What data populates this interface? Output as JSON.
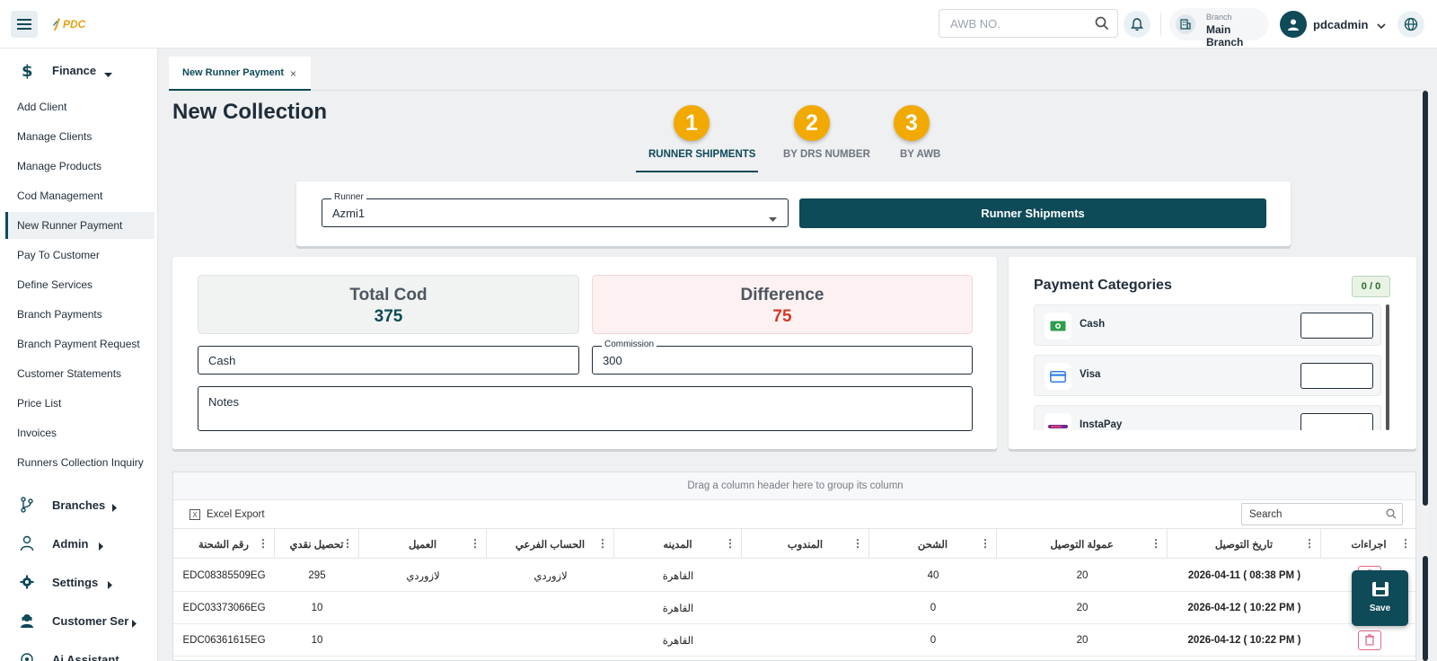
{
  "header": {
    "logo_text": "PDC",
    "awb_placeholder": "AWB NO.",
    "branch_label": "Branch",
    "branch_value": "Main Branch",
    "username": "pdcadmin"
  },
  "sidebar": {
    "finance_label": "Finance",
    "items": [
      {
        "label": "Add Client"
      },
      {
        "label": "Manage Clients"
      },
      {
        "label": "Manage Products"
      },
      {
        "label": "Cod Management"
      },
      {
        "label": "New Runner Payment"
      },
      {
        "label": "Pay To Customer"
      },
      {
        "label": "Define Services"
      },
      {
        "label": "Branch Payments"
      },
      {
        "label": "Branch Payment Request"
      },
      {
        "label": "Customer Statements"
      },
      {
        "label": "Price List"
      },
      {
        "label": "Invoices"
      },
      {
        "label": "Runners Collection Inquiry"
      }
    ],
    "sections": [
      {
        "label": "Branches"
      },
      {
        "label": "Admin"
      },
      {
        "label": "Settings"
      },
      {
        "label": "Customer Ser"
      },
      {
        "label": "Ai Assistant"
      }
    ]
  },
  "tabs": [
    {
      "label": "New Runner Payment",
      "close": "×"
    }
  ],
  "page": {
    "title": "New Collection"
  },
  "steps": [
    {
      "num": "1",
      "label": "RUNNER SHIPMENTS",
      "active": true
    },
    {
      "num": "2",
      "label": "BY DRS NUMBER",
      "active": false
    },
    {
      "num": "3",
      "label": "BY AWB",
      "active": false
    }
  ],
  "runner": {
    "label": "Runner",
    "value": "Azmi1",
    "button": "Runner Shipments"
  },
  "summary": {
    "total_cod_label": "Total Cod",
    "total_cod_value": "375",
    "difference_label": "Difference",
    "difference_value": "75",
    "payment_method": "Cash",
    "commission_label": "Commission",
    "commission_value": "300",
    "notes_label": "Notes"
  },
  "payment_categories": {
    "title": "Payment Categories",
    "badge": "0 / 0",
    "items": [
      {
        "label": "Cash",
        "icon": "cash-icon"
      },
      {
        "label": "Visa",
        "icon": "card-icon"
      },
      {
        "label": "InstaPay",
        "icon": "instapay-icon"
      }
    ]
  },
  "grid": {
    "group_hint": "Drag a column header here to group its column",
    "excel_label": "Excel Export",
    "search_placeholder": "Search",
    "columns": [
      "رقم الشحنة",
      "تحصيل نقدي",
      "العميل",
      "الحساب الفرعي",
      "المدينه",
      "المندوب",
      "الشحن",
      "عمولة التوصيل",
      "تاريخ التوصيل",
      "اجراءات"
    ],
    "rows": [
      {
        "awb": "EDC08385509EG",
        "cod": "295",
        "client": "لازوردي",
        "sub": "لازوردي",
        "city": "القاهرة",
        "runner": "",
        "shipping": "40",
        "commission": "20",
        "date": "2026-04-11 ( 08:38 PM )"
      },
      {
        "awb": "EDC03373066EG",
        "cod": "10",
        "client": "",
        "sub": "",
        "city": "القاهرة",
        "runner": "",
        "shipping": "0",
        "commission": "20",
        "date": "2026-04-12 ( 10:22 PM )"
      },
      {
        "awb": "EDC06361615EG",
        "cod": "10",
        "client": "",
        "sub": "",
        "city": "القاهرة",
        "runner": "",
        "shipping": "0",
        "commission": "20",
        "date": "2026-04-12 ( 10:22 PM )"
      }
    ]
  },
  "save_label": "Save",
  "colors": {
    "primary": "#0e4a58",
    "accent": "#f2a900",
    "difference": "#d03a2b",
    "total": "#0e4a58"
  }
}
